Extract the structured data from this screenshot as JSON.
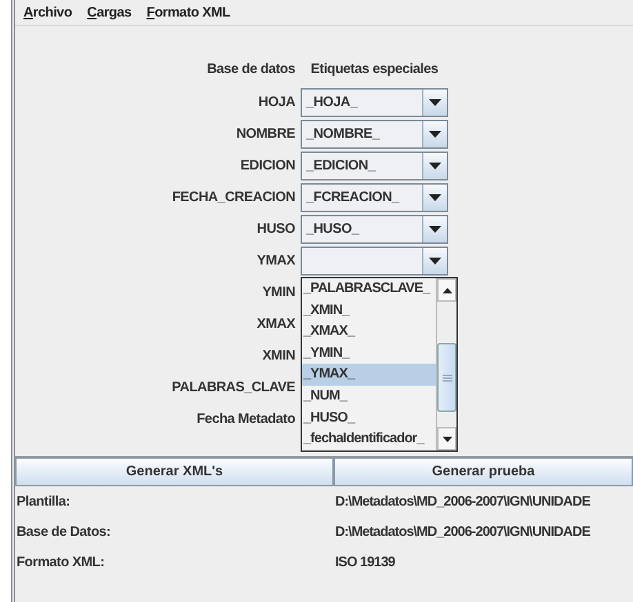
{
  "menu": [
    {
      "label": "Archivo"
    },
    {
      "label": "Cargas"
    },
    {
      "label": "Formato XML"
    }
  ],
  "headers": {
    "column_1": "Base de datos",
    "column_2": "Etiquetas especiales"
  },
  "fields": [
    {
      "kind": "combo",
      "label": "HOJA",
      "value": "_HOJA_"
    },
    {
      "kind": "combo",
      "label": "NOMBRE",
      "value": "_NOMBRE_"
    },
    {
      "kind": "combo",
      "label": "EDICION",
      "value": "_EDICION_"
    },
    {
      "kind": "combo",
      "label": "FECHA_CREACION",
      "value": "_FCREACION_"
    },
    {
      "kind": "combo",
      "label": "HUSO",
      "value": "_HUSO_"
    },
    {
      "kind": "combo",
      "label": "YMAX"
    },
    {
      "kind": "label",
      "label": "YMIN"
    },
    {
      "kind": "label",
      "label": "XMAX"
    },
    {
      "kind": "label",
      "label": "XMIN"
    },
    {
      "kind": "label",
      "label": "PALABRAS_CLAVE"
    },
    {
      "kind": "label",
      "label": "Fecha Metadato"
    }
  ],
  "dropdown": {
    "items": [
      {
        "label": "_PALABRASCLAVE_",
        "selected": false
      },
      {
        "label": "_XMIN_",
        "selected": false
      },
      {
        "label": "_XMAX_",
        "selected": false
      },
      {
        "label": "_YMIN_",
        "selected": false
      },
      {
        "label": "_YMAX_",
        "selected": true
      },
      {
        "label": "_NUM_",
        "selected": false
      },
      {
        "label": "_HUSO_",
        "selected": false
      },
      {
        "label": "_fechaIdentificador_",
        "selected": false
      }
    ]
  },
  "buttons": [
    "Generar XML's",
    "Generar prueba"
  ],
  "info": [
    {
      "label": "Plantilla:",
      "value": "D:\\Metadatos\\MD_2006-2007\\IGN\\UNIDADE"
    },
    {
      "label": "Base de Datos:",
      "value": "D:\\Metadatos\\MD_2006-2007\\IGN\\UNIDADE"
    },
    {
      "label": "Formato XML:",
      "value": "ISO 19139"
    }
  ]
}
